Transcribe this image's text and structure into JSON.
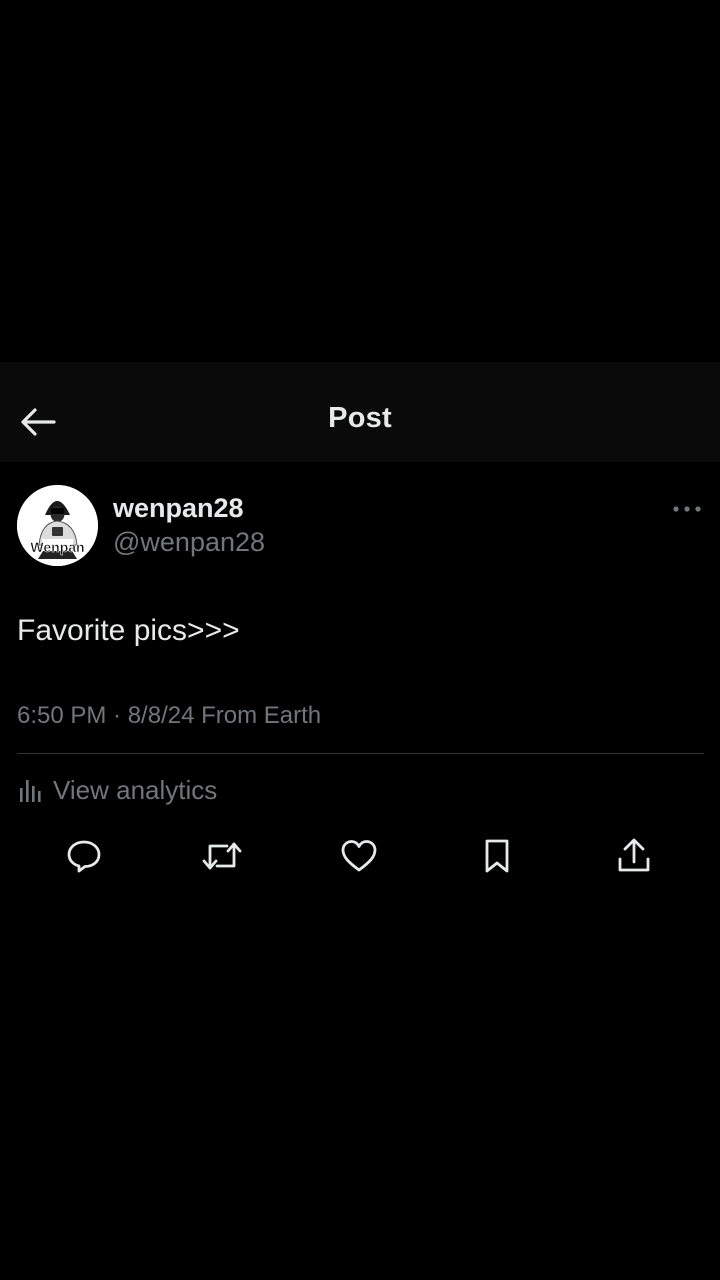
{
  "header": {
    "title": "Post",
    "back_icon": "arrow-left-icon"
  },
  "post": {
    "author": {
      "display_name": "wenpan28",
      "handle": "@wenpan28",
      "avatar_label": "Wenpan"
    },
    "text": "Favorite pics>>>",
    "meta": "6:50 PM · 8/8/24 From Earth",
    "more_icon": "more-horizontal-icon"
  },
  "analytics": {
    "label": "View analytics",
    "icon": "bar-chart-icon"
  },
  "actions": [
    {
      "name": "reply",
      "icon": "reply-icon"
    },
    {
      "name": "repost",
      "icon": "repost-icon"
    },
    {
      "name": "like",
      "icon": "heart-icon"
    },
    {
      "name": "bookmark",
      "icon": "bookmark-icon"
    },
    {
      "name": "share",
      "icon": "share-icon"
    }
  ],
  "colors": {
    "background": "#000000",
    "header_background": "#0a0a0a",
    "primary_text": "#e7e9ea",
    "secondary_text": "#71767b",
    "divider": "#2f3336"
  }
}
